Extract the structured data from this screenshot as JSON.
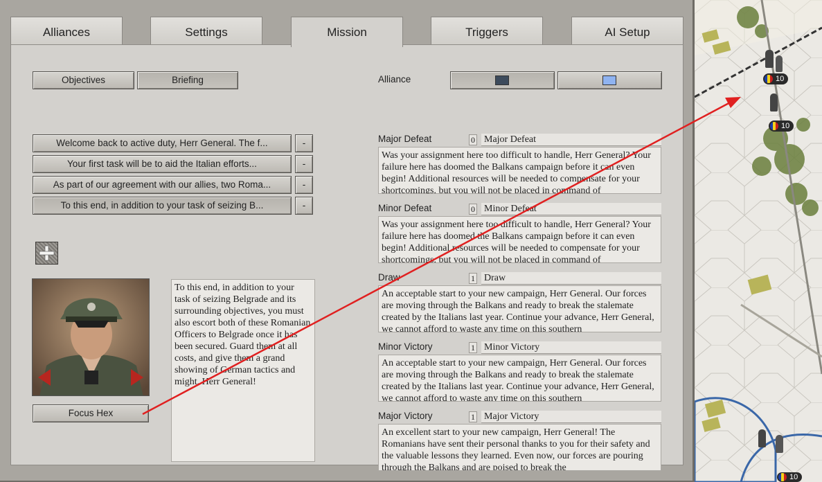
{
  "tabs": [
    {
      "label": "Alliances"
    },
    {
      "label": "Settings"
    },
    {
      "label": "Mission"
    },
    {
      "label": "Triggers"
    },
    {
      "label": "AI Setup"
    }
  ],
  "subtabs": {
    "objectives": "Objectives",
    "briefing": "Briefing"
  },
  "alliance": {
    "label": "Alliance",
    "colors": [
      "#3d4b5c",
      "#8fb3f0"
    ]
  },
  "briefing_items": [
    {
      "text": "Welcome back to active duty, Herr General.   The f...",
      "remove": "-"
    },
    {
      "text": "Your first task will be to aid the Italian efforts...",
      "remove": "-"
    },
    {
      "text": "As part of our agreement with our allies, two Roma...",
      "remove": "-"
    },
    {
      "text": "To this end, in addition to your task of seizing B...",
      "remove": "-"
    }
  ],
  "add_icon": "plus-icon",
  "briefing_text": "To this end, in addition to your task of seizing Belgrade and its surrounding objectives, you must also escort both of these Romanian Officers to Belgrade once it has been secured.  Guard them at all costs, and give them a grand showing of German tactics and might, Herr General!",
  "focus_button": "Focus Hex",
  "outcomes": [
    {
      "label": "Major Defeat",
      "value": "0",
      "name": "Major Defeat",
      "text": "Was your assignment here too difficult to handle, Herr General? Your failure here has doomed the Balkans campaign before it can even begin!  Additional resources will be needed to compensate for your shortcomings, but you will not be placed in command of"
    },
    {
      "label": "Minor Defeat",
      "value": "0",
      "name": "Minor Defeat",
      "text": "Was your assignment here too difficult to handle, Herr General? Your failure here has doomed the Balkans campaign before it can even begin!  Additional resources will be needed to compensate for your shortcomings, but you will not be placed in command of"
    },
    {
      "label": "Draw",
      "value": "1",
      "name": "Draw",
      "text": "An acceptable start to your new campaign, Herr General.  Our forces are moving through the Balkans and ready to break the stalemate created by the Italians last year.  Continue your advance, Herr General, we cannot afford to waste any time on this southern"
    },
    {
      "label": "Minor Victory",
      "value": "1",
      "name": "Minor Victory",
      "text": "An acceptable start to your new campaign, Herr General.  Our forces are moving through the Balkans and ready to break the stalemate created by the Italians last year.  Continue your advance, Herr General, we cannot afford to waste any time on this southern"
    },
    {
      "label": "Major Victory",
      "value": "1",
      "name": "Major Victory",
      "text": "An excellent start to your new campaign, Herr General!  The Romanians have sent their personal thanks to you for their safety and the valuable lessons they learned.  Even now, our forces are pouring through the Balkans and are poised to break the"
    }
  ],
  "map_units": [
    {
      "strength": "10"
    },
    {
      "strength": "10"
    },
    {
      "strength": "10"
    }
  ],
  "colors": {
    "arrow": "#e02020",
    "accent": "#d3d1cd"
  }
}
